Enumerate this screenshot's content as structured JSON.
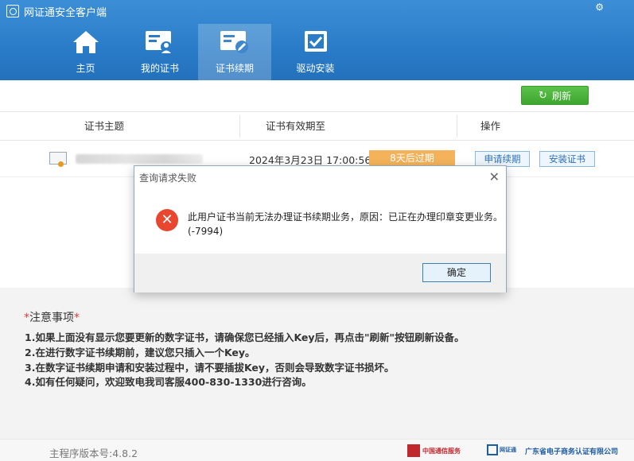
{
  "app": {
    "title": "网证通安全客户端"
  },
  "nav": {
    "items": [
      {
        "label": "主页",
        "icon": "home-icon"
      },
      {
        "label": "我的证书",
        "icon": "certificate-card-icon"
      },
      {
        "label": "证书续期",
        "icon": "certificate-renew-icon"
      },
      {
        "label": "驱动安装",
        "icon": "driver-checkbox-icon"
      }
    ],
    "active": "证书续期"
  },
  "toolbar": {
    "refresh_label": "刷新"
  },
  "table": {
    "headers": [
      "证书主题",
      "证书有效期至",
      "操作"
    ],
    "rows": [
      {
        "expiry": "2024年3月23日 17:00:56",
        "badge": "8天后过期",
        "actions": [
          "申请续期",
          "安装证书"
        ]
      }
    ]
  },
  "notes": {
    "title": "注意事项",
    "star": "*",
    "items": [
      "1.如果上面没有显示您要更新的数字证书，请确保您已经插入Key后，再点击\"刷新\"按钮刷新设备。",
      "2.在进行数字证书续期前，建议您只插入一个Key。",
      "3.在数字证书续期申请和安装过程中，请不要插拔Key，否则会导致数字证书损坏。",
      "4.如有任何疑问，欢迎致电我司客服400-830-1330进行咨询。"
    ]
  },
  "footer": {
    "version": "主程序版本号:4.8.2",
    "logo1": "中国通信服务",
    "logo2": "网证通",
    "logo3": "广东省电子商务认证有限公司"
  },
  "dialog": {
    "title": "查询请求失败",
    "message_line1": "此用户证书当前无法办理证书续期业务，原因：已正在办理印章变更业务。",
    "message_line2": "(-7994)",
    "ok_label": "确定"
  },
  "colors": {
    "header": "#2a7cc8",
    "refresh": "#4cb43c",
    "badge": "#f4b35a",
    "error": "#e8462e"
  }
}
